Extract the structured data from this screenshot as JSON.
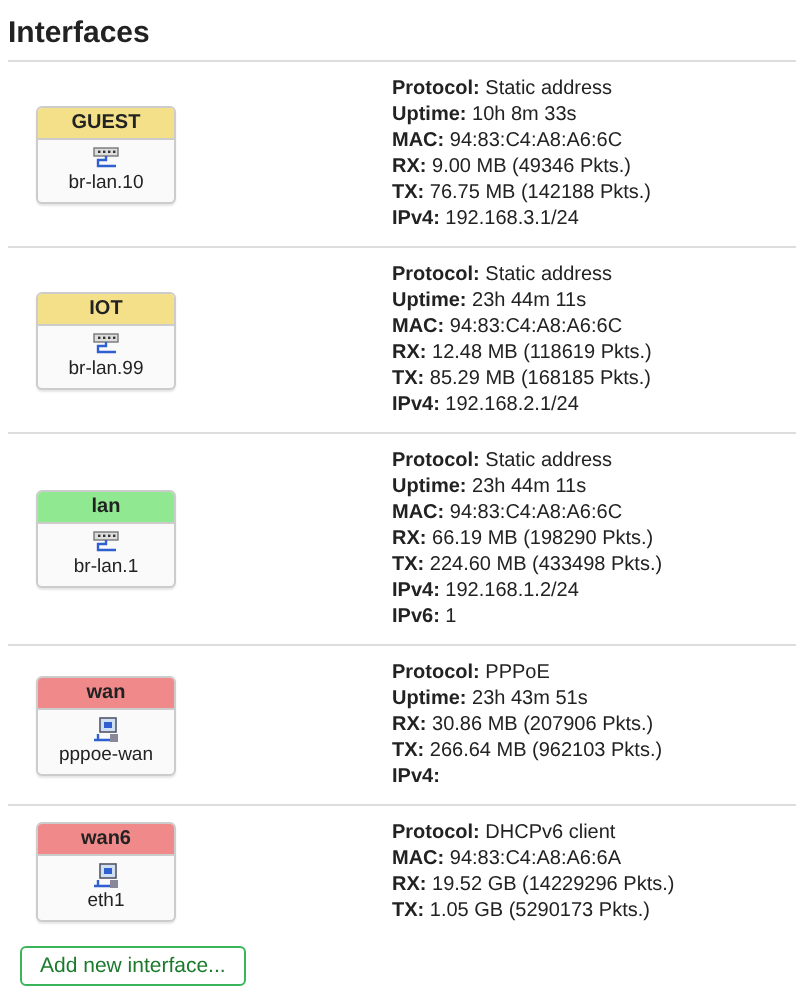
{
  "title": "Interfaces",
  "interfaces": [
    {
      "name": "GUEST",
      "color": "#f5e08a",
      "device": "br-lan.10",
      "kind": "bridge",
      "details": [
        {
          "label": "Protocol:",
          "value": "Static address"
        },
        {
          "label": "Uptime:",
          "value": "10h 8m 33s"
        },
        {
          "label": "MAC:",
          "value": "94:83:C4:A8:A6:6C"
        },
        {
          "label": "RX:",
          "value": "9.00 MB (49346 Pkts.)"
        },
        {
          "label": "TX:",
          "value": "76.75 MB (142188 Pkts.)"
        },
        {
          "label": "IPv4:",
          "value": "192.168.3.1/24"
        }
      ]
    },
    {
      "name": "IOT",
      "color": "#f5e08a",
      "device": "br-lan.99",
      "kind": "bridge",
      "details": [
        {
          "label": "Protocol:",
          "value": "Static address"
        },
        {
          "label": "Uptime:",
          "value": "23h 44m 11s"
        },
        {
          "label": "MAC:",
          "value": "94:83:C4:A8:A6:6C"
        },
        {
          "label": "RX:",
          "value": "12.48 MB (118619 Pkts.)"
        },
        {
          "label": "TX:",
          "value": "85.29 MB (168185 Pkts.)"
        },
        {
          "label": "IPv4:",
          "value": "192.168.2.1/24"
        }
      ]
    },
    {
      "name": "lan",
      "color": "#90e890",
      "device": "br-lan.1",
      "kind": "bridge",
      "details": [
        {
          "label": "Protocol:",
          "value": "Static address"
        },
        {
          "label": "Uptime:",
          "value": "23h 44m 11s"
        },
        {
          "label": "MAC:",
          "value": "94:83:C4:A8:A6:6C"
        },
        {
          "label": "RX:",
          "value": "66.19 MB (198290 Pkts.)"
        },
        {
          "label": "TX:",
          "value": "224.60 MB (433498 Pkts.)"
        },
        {
          "label": "IPv4:",
          "value": "192.168.1.2/24"
        },
        {
          "label": "IPv6:",
          "value": "1"
        }
      ]
    },
    {
      "name": "wan",
      "color": "#f08a8a",
      "device": "pppoe-wan",
      "kind": "ethernet",
      "details": [
        {
          "label": "Protocol:",
          "value": "PPPoE"
        },
        {
          "label": "Uptime:",
          "value": "23h 43m 51s"
        },
        {
          "label": "RX:",
          "value": "30.86 MB (207906 Pkts.)"
        },
        {
          "label": "TX:",
          "value": "266.64 MB (962103 Pkts.)"
        },
        {
          "label": "IPv4:"
        }
      ]
    },
    {
      "name": "wan6",
      "color": "#f08a8a",
      "device": "eth1",
      "kind": "ethernet",
      "details": [
        {
          "label": "Protocol:",
          "value": "DHCPv6 client"
        },
        {
          "label": "MAC:",
          "value": "94:83:C4:A8:A6:6A"
        },
        {
          "label": "RX:",
          "value": "19.52 GB (14229296 Pkts.)"
        },
        {
          "label": "TX:",
          "value": "1.05 GB (5290173 Pkts.)"
        }
      ]
    }
  ],
  "add_button": "Add new interface..."
}
